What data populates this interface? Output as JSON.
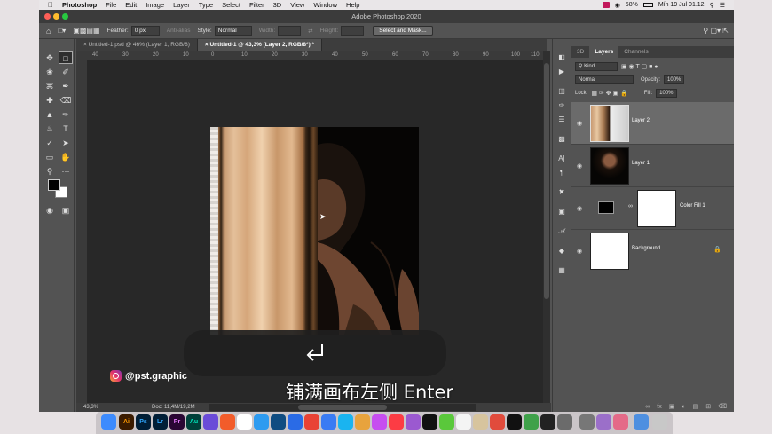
{
  "menubar": {
    "items": [
      "Photoshop",
      "File",
      "Edit",
      "Image",
      "Layer",
      "Type",
      "Select",
      "Filter",
      "3D",
      "View",
      "Window",
      "Help"
    ],
    "battery": "58%",
    "clock": "Mín 19 Jul 01.12"
  },
  "window": {
    "title": "Adobe Photoshop 2020"
  },
  "options": {
    "feather_label": "Feather:",
    "feather_value": "0 px",
    "antialias": "Anti-alias",
    "style_label": "Style:",
    "style_value": "Normal",
    "width_label": "Width:",
    "height_label": "Height:",
    "select_mask": "Select and Mask..."
  },
  "tabs": [
    {
      "label": "Untitled-1.psd @ 46% (Layer 1, RGB/8)"
    },
    {
      "label": "Untitled-1 @ 43,3% (Layer 2, RGB/8*) *"
    }
  ],
  "ruler": {
    "h_labels": [
      "40",
      "30",
      "20",
      "10",
      "0",
      "10",
      "20",
      "30",
      "40",
      "50",
      "60",
      "70",
      "80",
      "90",
      "100",
      "110"
    ]
  },
  "status": {
    "zoom": "43,3%",
    "doc": "Doc: 11,4M/19,2M"
  },
  "panel": {
    "tabs": [
      "3D",
      "Layers",
      "Channels"
    ],
    "kind": "Kind",
    "blend": "Normal",
    "opacity_label": "Opacity:",
    "opacity": "100%",
    "lock_label": "Lock:",
    "fill_label": "Fill:",
    "fill": "100%",
    "layers": [
      {
        "name": "Layer 2"
      },
      {
        "name": "Layer 1"
      },
      {
        "name": "Color Fill 1"
      },
      {
        "name": "Background"
      }
    ]
  },
  "overlay": {
    "watermark": "@pst.graphic",
    "subtitle": "铺满画布左侧 Enter"
  },
  "dock": {
    "apps": [
      "F",
      "Ai",
      "Ps",
      "Lr",
      "Pr",
      "Au",
      "",
      "",
      "",
      "",
      "",
      "",
      "",
      "",
      "",
      "",
      "",
      "",
      "",
      "",
      "",
      "",
      "",
      "",
      "",
      "",
      "",
      "",
      "",
      "",
      "",
      "",
      "",
      "",
      ""
    ]
  }
}
